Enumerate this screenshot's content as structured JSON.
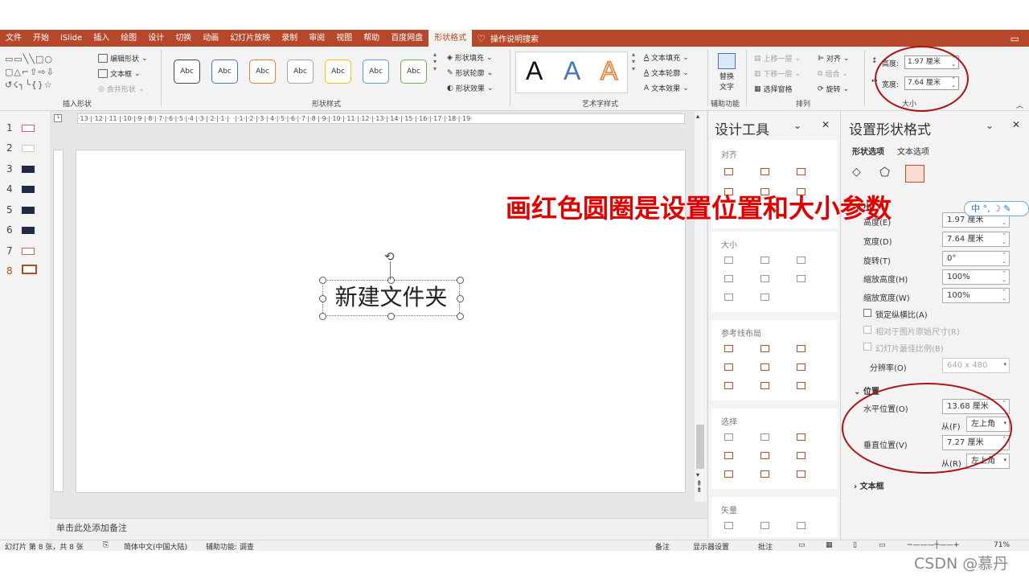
{
  "menu": {
    "tabs": [
      "文件",
      "开始",
      "iSlide",
      "插入",
      "绘图",
      "设计",
      "切换",
      "动画",
      "幻灯片放映",
      "录制",
      "审阅",
      "视图",
      "帮助",
      "百度网盘",
      "形状格式"
    ],
    "active_tab": "形状格式",
    "tell_me": "操作说明搜索"
  },
  "ribbon": {
    "insert_shapes": {
      "edit_shape": "编辑形状",
      "text_box": "文本框",
      "merge_shapes": "合并形状",
      "label": "插入形状"
    },
    "shape_styles": {
      "style_label": "Abc",
      "fill": "形状填充",
      "outline": "形状轮廓",
      "effects": "形状效果",
      "label": "形状样式",
      "style_colors": [
        "#444444",
        "#4472c4",
        "#ed7d31",
        "#a5a5a5",
        "#ffc000",
        "#5b9bd5",
        "#70ad47"
      ]
    },
    "wordart": {
      "letter": "A",
      "text_fill": "文本填充",
      "text_outline": "文本轮廓",
      "text_effects": "文本效果",
      "label": "艺术字样式"
    },
    "accessibility": {
      "alt_text_line1": "替换",
      "alt_text_line2": "文字",
      "label": "辅助功能"
    },
    "arrange": {
      "bring_forward": "上移一层",
      "send_backward": "下移一层",
      "selection_pane": "选择窗格",
      "align": "对齐",
      "group": "组合",
      "rotate": "旋转",
      "label": "排列"
    },
    "size": {
      "height_label": "高度:",
      "height_value": "1.97 厘米",
      "width_label": "宽度:",
      "width_value": "7.64 厘米",
      "label": "大小"
    }
  },
  "slides": {
    "numbers": [
      "1",
      "2",
      "3",
      "4",
      "5",
      "6",
      "7",
      "8"
    ],
    "active": "8"
  },
  "ruler": {
    "horizontal": "·13·|·12·|·11·|·10·|·9·|·8·|·7·|·6·|·5·|·4·|·3·|·2·|·1·|·   ·|·1·|·2·|·3·|·4·|·5·|·6·|·7·|·8·|·9·|·10·|·11·|·12·|·13·|·14·|·15·|·16·|·17·|·18·|·19·"
  },
  "canvas": {
    "shape_text": "新建文件夹",
    "annotation": "画红色圆圈是设置位置和大小参数"
  },
  "notes": {
    "placeholder": "单击此处添加备注"
  },
  "design_tools": {
    "title": "设计工具",
    "sections": [
      "对齐",
      "大小",
      "参考线布局",
      "选择",
      "矢量"
    ]
  },
  "format_pane": {
    "title": "设置形状格式",
    "tabs": [
      "形状选项",
      "文本选项"
    ],
    "size_section": "大小",
    "height_label": "高度(E)",
    "height_value": "1.97 厘米",
    "width_label": "宽度(D)",
    "width_value": "7.64 厘米",
    "rotation_label": "旋转(T)",
    "rotation_value": "0°",
    "scale_height_label": "缩放高度(H)",
    "scale_height_value": "100%",
    "scale_width_label": "缩放宽度(W)",
    "scale_width_value": "100%",
    "lock_aspect": "锁定纵横比(A)",
    "relative_original": "相对于图片原始尺寸(R)",
    "best_slideshow": "幻灯片最佳比例(B)",
    "resolution_label": "分辨率(O)",
    "resolution_value": "640 x 480",
    "position_section": "位置",
    "horizontal_label": "水平位置(O)",
    "horizontal_value": "13.68 厘米",
    "from_label_h": "从(F)",
    "from_value_h": "左上角",
    "vertical_label": "垂直位置(V)",
    "vertical_value": "7.27 厘米",
    "from_label_v": "从(R)",
    "from_value_v": "左上角",
    "textbox_section": "文本框"
  },
  "ime": {
    "text": "中 °, ☽ ✎"
  },
  "status": {
    "slide": "幻灯片 第 8 张，共 8 张",
    "language": "简体中文(中国大陆)",
    "accessibility": "辅助功能: 调查",
    "notes": "备注",
    "display": "显示器设置",
    "comments": "批注",
    "zoom": "71%"
  },
  "watermark": "CSDN @慕丹",
  "colors": {
    "accent": "#b7472a",
    "annotation": "#e00000",
    "circle": "#b01010"
  }
}
